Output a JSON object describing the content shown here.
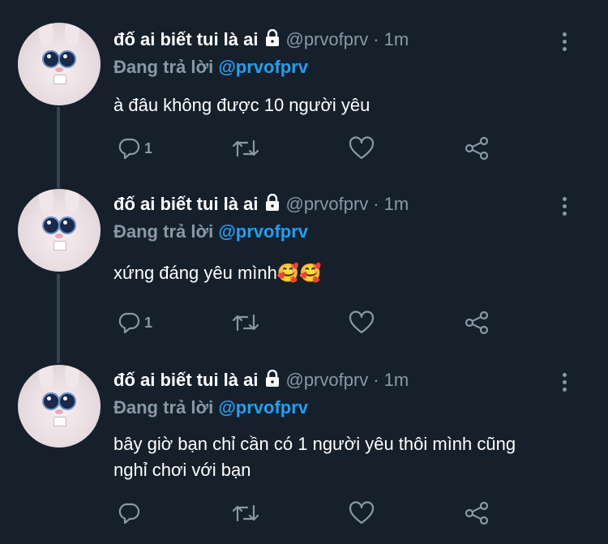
{
  "tweets": [
    {
      "display_name": "đố ai biết tui là ai",
      "handle": "@prvofprv",
      "separator": "·",
      "time": "1m",
      "reply_prefix": "Đang trả lời",
      "reply_to": "@prvofprv",
      "text": "à đâu không được 10 người yêu",
      "reply_count": "1"
    },
    {
      "display_name": "đố ai biết tui là ai",
      "handle": "@prvofprv",
      "separator": "·",
      "time": "1m",
      "reply_prefix": "Đang trả lời",
      "reply_to": "@prvofprv",
      "text": "xứng đáng yêu mình🥰🥰",
      "reply_count": "1"
    },
    {
      "display_name": "đố ai biết tui là ai",
      "handle": "@prvofprv",
      "separator": "·",
      "time": "1m",
      "reply_prefix": "Đang trả lời",
      "reply_to": "@prvofprv",
      "text": "bây giờ bạn chỉ cần có 1 người yêu thôi mình cũng nghỉ chơi với bạn",
      "reply_count": ""
    }
  ],
  "icons": {
    "lock": "lock-icon",
    "more": "more-vertical-icon",
    "reply": "reply-icon",
    "retweet": "retweet-icon",
    "like": "heart-icon",
    "share": "share-icon"
  },
  "colors": {
    "background": "#15202b",
    "text": "#ffffff",
    "muted": "#8899a6",
    "mention": "#1da1f2",
    "thread_line": "#38444d"
  }
}
